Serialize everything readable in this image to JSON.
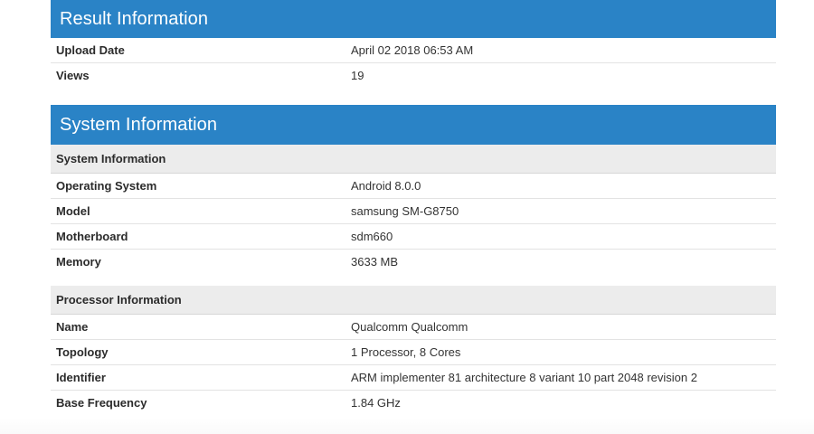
{
  "result": {
    "title": "Result Information",
    "rows": [
      {
        "label": "Upload Date",
        "value": "April 02 2018 06:53 AM"
      },
      {
        "label": "Views",
        "value": "19"
      }
    ]
  },
  "system": {
    "title": "System Information",
    "sections": [
      {
        "heading": "System Information",
        "rows": [
          {
            "label": "Operating System",
            "value": "Android 8.0.0"
          },
          {
            "label": "Model",
            "value": "samsung SM-G8750"
          },
          {
            "label": "Motherboard",
            "value": "sdm660"
          },
          {
            "label": "Memory",
            "value": "3633 MB"
          }
        ]
      },
      {
        "heading": "Processor Information",
        "rows": [
          {
            "label": "Name",
            "value": "Qualcomm Qualcomm"
          },
          {
            "label": "Topology",
            "value": "1 Processor, 8 Cores"
          },
          {
            "label": "Identifier",
            "value": "ARM implementer 81 architecture 8 variant 10 part 2048 revision 2"
          },
          {
            "label": "Base Frequency",
            "value": "1.84 GHz"
          }
        ]
      }
    ]
  },
  "colors": {
    "header_bg": "#2a83c6",
    "section_bg": "#ececec"
  }
}
